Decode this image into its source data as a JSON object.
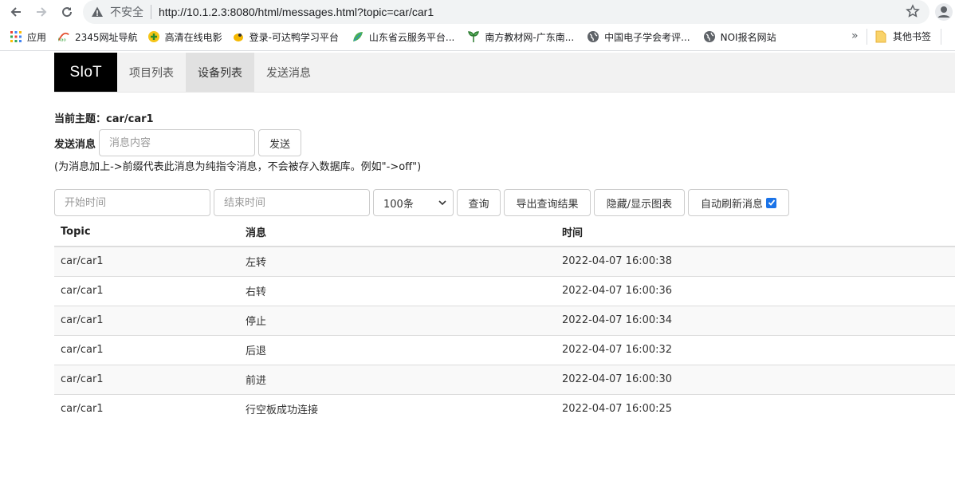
{
  "browser": {
    "security_label": "不安全",
    "url": "http://10.1.2.3:8080/html/messages.html?topic=car/car1"
  },
  "bookmarks": {
    "items": [
      {
        "label": "应用",
        "icon": "apps-grid-icon"
      },
      {
        "label": "2345网址导航",
        "icon": "hao-icon"
      },
      {
        "label": "高清在线电影",
        "icon": "plus-circle-icon"
      },
      {
        "label": "登录-可达鸭学习平台",
        "icon": "duck-icon"
      },
      {
        "label": "山东省云服务平台...",
        "icon": "leaf-icon"
      },
      {
        "label": "南方教材网-广东南...",
        "icon": "sprout-icon"
      },
      {
        "label": "中国电子学会考评...",
        "icon": "globe-icon"
      },
      {
        "label": "NOI报名网站",
        "icon": "globe-icon"
      }
    ],
    "more": "»",
    "other_folder": "其他书签"
  },
  "nav": {
    "brand": "SIoT",
    "links": [
      "项目列表",
      "设备列表",
      "发送消息"
    ],
    "active_index": 1
  },
  "topic": {
    "label": "当前主题：car/car1"
  },
  "send": {
    "label": "发送消息",
    "placeholder": "消息内容",
    "button": "发送",
    "hint": "(为消息加上->前缀代表此消息为纯指令消息，不会被存入数据库。例如\"->off\")"
  },
  "filter": {
    "start_placeholder": "开始时间",
    "end_placeholder": "结束时间",
    "count_selected": "100条",
    "query": "查询",
    "export": "导出查询结果",
    "toggle_chart": "隐藏/显示图表",
    "auto_refresh": "自动刷新消息",
    "auto_refresh_checked": true
  },
  "table": {
    "columns": [
      "Topic",
      "消息",
      "时间"
    ],
    "rows": [
      [
        "car/car1",
        "左转",
        "2022-04-07 16:00:38"
      ],
      [
        "car/car1",
        "右转",
        "2022-04-07 16:00:36"
      ],
      [
        "car/car1",
        "停止",
        "2022-04-07 16:00:34"
      ],
      [
        "car/car1",
        "后退",
        "2022-04-07 16:00:32"
      ],
      [
        "car/car1",
        "前进",
        "2022-04-07 16:00:30"
      ],
      [
        "car/car1",
        "行空板成功连接",
        "2022-04-07 16:00:25"
      ]
    ]
  }
}
